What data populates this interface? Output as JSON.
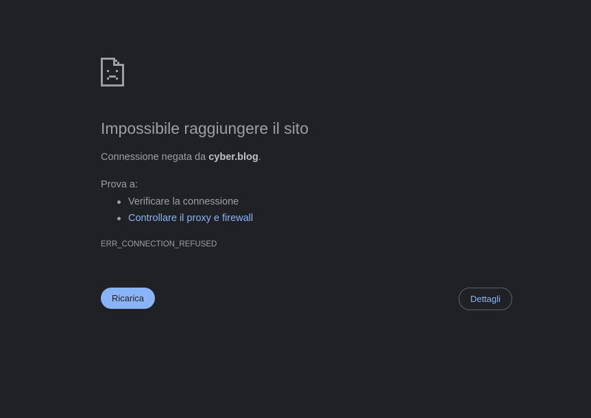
{
  "page": {
    "title": "Impossibile raggiungere il sito",
    "message_prefix": "Connessione negata da ",
    "host": "cyber.blog",
    "message_suffix": ".",
    "try_label": "Prova a:",
    "suggestions": [
      {
        "label": "Verificare la connessione",
        "is_link": false
      },
      {
        "label": "Controllare il proxy e firewall",
        "is_link": true
      }
    ],
    "error_code": "ERR_CONNECTION_REFUSED"
  },
  "buttons": {
    "reload_label": "Ricarica",
    "details_label": "Dettagli"
  },
  "icon": {
    "name": "sad-document-icon",
    "color": "#9aa0a6"
  },
  "colors": {
    "background": "#202124",
    "text": "#9aa0a6",
    "accent": "#8ab4f8",
    "border": "#5f6368"
  }
}
